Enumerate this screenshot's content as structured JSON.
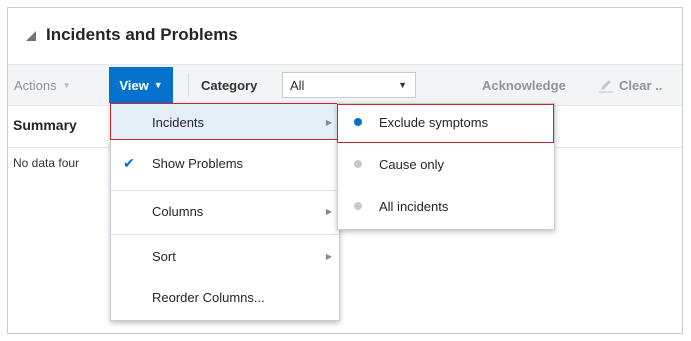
{
  "panel": {
    "title": "Incidents and Problems",
    "collapse_icon": "collapse-triangle-icon"
  },
  "toolbar": {
    "actions_label": "Actions",
    "view_label": "View",
    "category_label": "Category",
    "category_value": "All",
    "acknowledge_label": "Acknowledge",
    "clear_label": "Clear ..",
    "clear_icon": "pencil-icon",
    "dropdown_icon": "caret-down-icon"
  },
  "table": {
    "summary_header": "Summary",
    "no_data_text": "No data four"
  },
  "view_menu": {
    "items": [
      {
        "label": "Incidents",
        "has_submenu": true,
        "checked": false,
        "highlighted": true
      },
      {
        "label": "Show Problems",
        "has_submenu": false,
        "checked": true
      },
      {
        "label": "Columns",
        "has_submenu": true,
        "checked": false
      },
      {
        "label": "Sort",
        "has_submenu": true,
        "checked": false
      },
      {
        "label": "Reorder Columns...",
        "has_submenu": false,
        "checked": false
      }
    ]
  },
  "incidents_submenu": {
    "items": [
      {
        "label": "Exclude symptoms",
        "selected": true
      },
      {
        "label": "Cause only",
        "selected": false
      },
      {
        "label": "All incidents",
        "selected": false
      }
    ]
  },
  "colors": {
    "accent": "#0572ce",
    "highlight_border": "#d0242e",
    "toolbar_bg": "#f2f4f5"
  }
}
